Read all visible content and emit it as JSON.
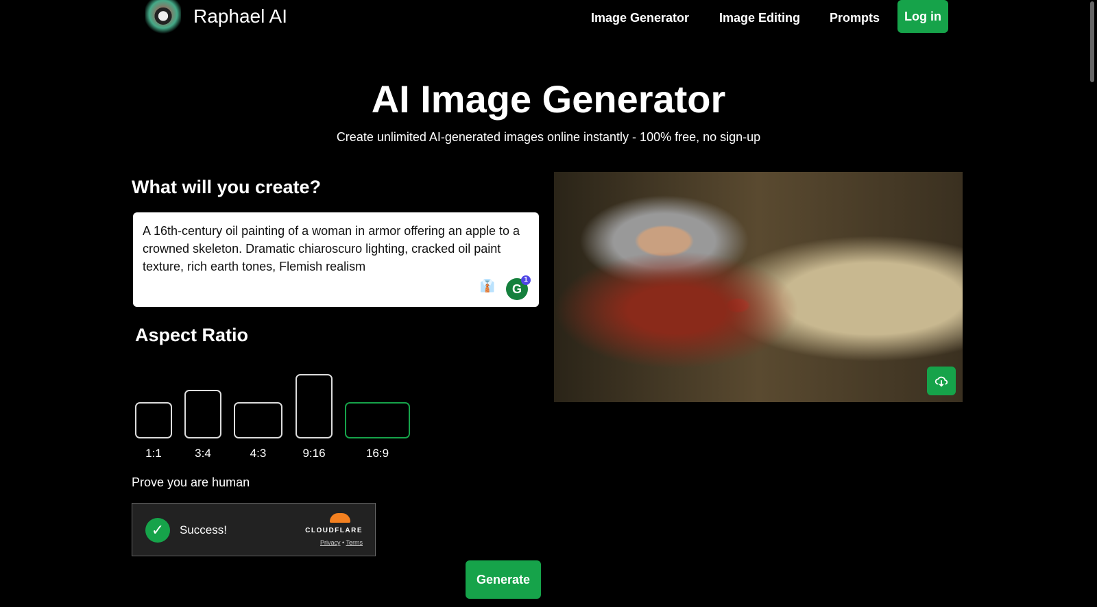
{
  "header": {
    "brand": "Raphael AI",
    "nav": [
      "Image Generator",
      "Image Editing",
      "Prompts"
    ],
    "login": "Log in"
  },
  "hero": {
    "title": "AI Image Generator",
    "subtitle": "Create unlimited AI-generated images online instantly - 100% free, no sign-up"
  },
  "form": {
    "heading": "What will you create?",
    "prompt": "A 16th-century oil painting of a woman in armor offering an apple to a crowned skeleton. Dramatic chiaroscuro lighting, cracked oil paint texture, rich earth tones, Flemish realism",
    "grammarly_count": "1",
    "aspect_heading": "Aspect Ratio",
    "ratios": [
      "1:1",
      "3:4",
      "4:3",
      "9:16",
      "16:9"
    ],
    "selected_ratio": "16:9",
    "human_label": "Prove you are human",
    "captcha": {
      "status": "Success!",
      "brand": "CLOUDFLARE",
      "privacy": "Privacy",
      "sep": "•",
      "terms": "Terms"
    },
    "generate": "Generate"
  },
  "colors": {
    "accent": "#16a34a",
    "cloud": "#f38020"
  }
}
